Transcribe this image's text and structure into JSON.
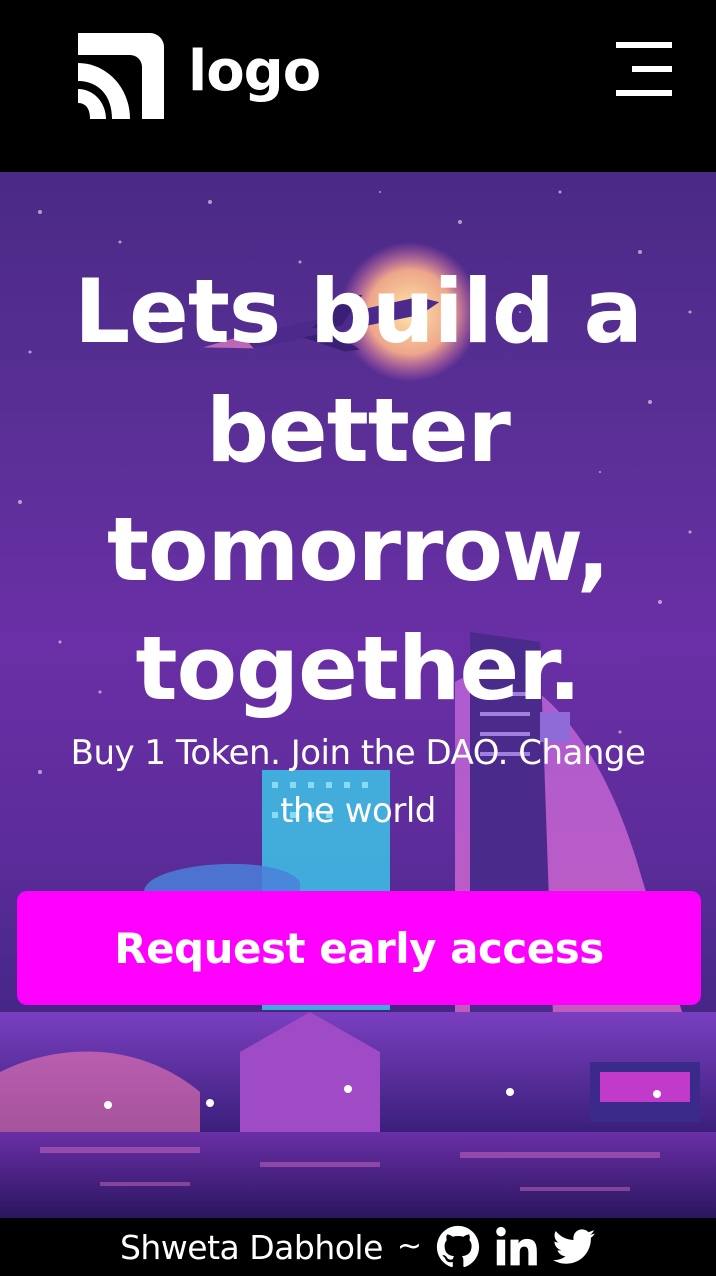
{
  "header": {
    "logo_text": "logo",
    "menu_icon": "hamburger-menu-icon"
  },
  "hero": {
    "title_lines": [
      "Lets build a",
      "better",
      "tomorrow,",
      "together."
    ],
    "subtitle_lines": [
      "Buy 1 Token. Join the DAO. Change",
      "the world"
    ],
    "cta_label": "Request early access",
    "background": "synthwave-city-night-illustration"
  },
  "footer": {
    "author": "Shweta Dabhole",
    "separator": "~",
    "social_icons": [
      "github-icon",
      "linkedin-icon",
      "twitter-icon"
    ]
  },
  "colors": {
    "header_bg": "#000000",
    "cta_bg": "#ff00ff",
    "text": "#ffffff",
    "hero_purple": "#5a2f96"
  }
}
